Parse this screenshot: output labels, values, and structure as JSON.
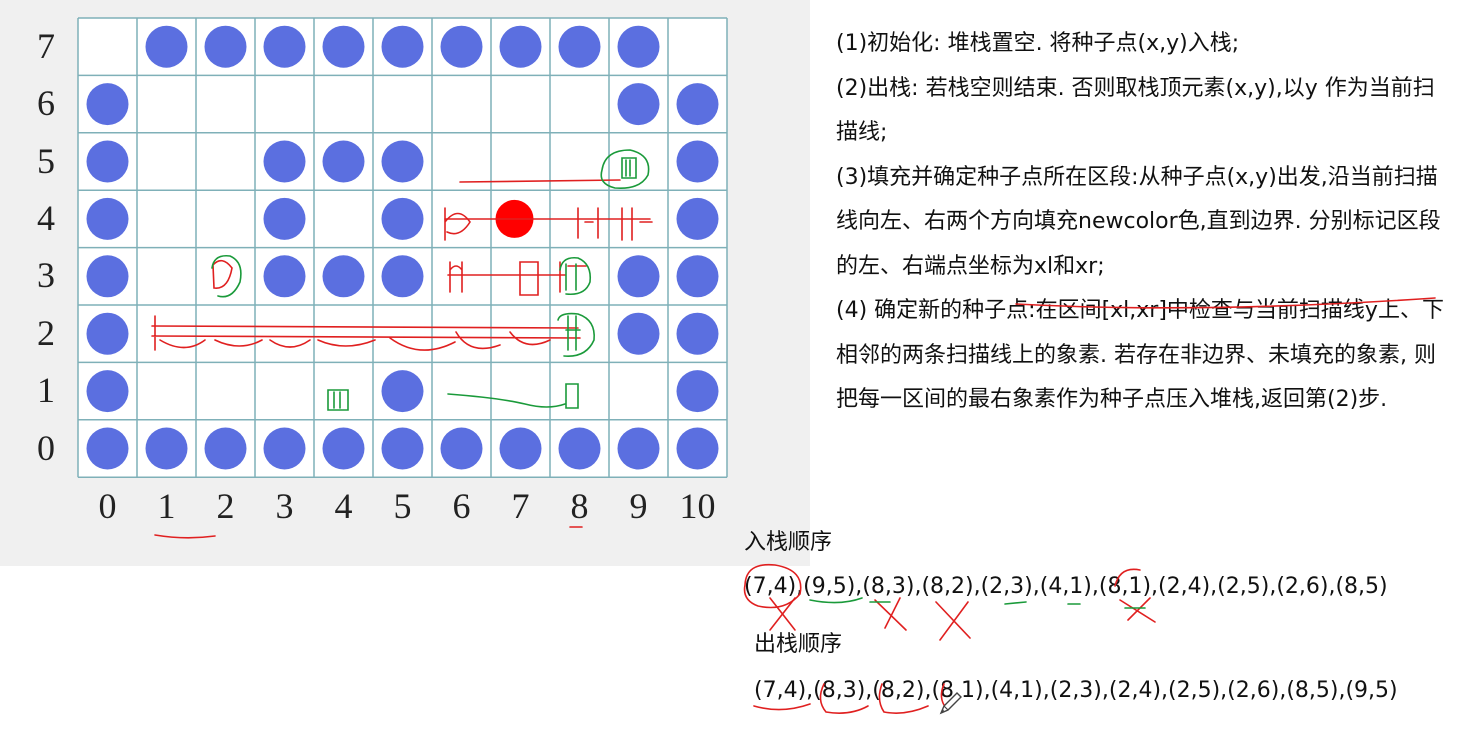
{
  "grid": {
    "x_labels": [
      "0",
      "1",
      "2",
      "3",
      "4",
      "5",
      "6",
      "7",
      "8",
      "9",
      "10"
    ],
    "y_labels": [
      "7",
      "6",
      "5",
      "4",
      "3",
      "2",
      "1",
      "0"
    ],
    "cell_color": "#ffffff",
    "line_color": "#7fb0b8",
    "dot_color": "#5b6fe0",
    "seed_color": "#ff0000",
    "boundary_dots": [
      [
        1,
        7
      ],
      [
        2,
        7
      ],
      [
        3,
        7
      ],
      [
        4,
        7
      ],
      [
        5,
        7
      ],
      [
        6,
        7
      ],
      [
        7,
        7
      ],
      [
        8,
        7
      ],
      [
        9,
        7
      ],
      [
        0,
        6
      ],
      [
        9,
        6
      ],
      [
        10,
        6
      ],
      [
        0,
        5
      ],
      [
        3,
        5
      ],
      [
        4,
        5
      ],
      [
        5,
        5
      ],
      [
        10,
        5
      ],
      [
        0,
        4
      ],
      [
        3,
        4
      ],
      [
        5,
        4
      ],
      [
        10,
        4
      ],
      [
        0,
        3
      ],
      [
        3,
        3
      ],
      [
        4,
        3
      ],
      [
        5,
        3
      ],
      [
        9,
        3
      ],
      [
        10,
        3
      ],
      [
        0,
        2
      ],
      [
        9,
        2
      ],
      [
        10,
        2
      ],
      [
        0,
        1
      ],
      [
        5,
        1
      ],
      [
        10,
        1
      ],
      [
        0,
        0
      ],
      [
        1,
        0
      ],
      [
        2,
        0
      ],
      [
        3,
        0
      ],
      [
        4,
        0
      ],
      [
        5,
        0
      ],
      [
        6,
        0
      ],
      [
        7,
        0
      ],
      [
        8,
        0
      ],
      [
        9,
        0
      ],
      [
        10,
        0
      ]
    ],
    "seed_point": [
      7,
      4
    ]
  },
  "steps": [
    "(1)初始化: 堆栈置空. 将种子点(x,y)入栈;",
    "(2)出栈: 若栈空则结束. 否则取栈顶元素(x,y),以y 作为当前扫描线;",
    "(3)填充并确定种子点所在区段:从种子点(x,y)出发,沿当前扫描线向左、右两个方向填充newcolor色,直到边界. 分别标记区段的左、右端点坐标为xl和xr;",
    "(4) 确定新的种子点:在区间[xl,xr]中检查与当前扫描线y上、下相邻的两条扫描线上的象素. 若存在非边界、未填充的象素, 则把每一区间的最右象素作为种子点压入堆栈,返回第(2)步."
  ],
  "push_order": {
    "title": "入栈顺序",
    "sequence": "(7,4),(9,5),(8,3),(8,2),(2,3),(4,1),(8,1),(2,4),(2,5),(2,6),(8,5)"
  },
  "pop_order": {
    "title": "出栈顺序",
    "sequence": "(7,4),(8,3),(8,2),(8,1),(4,1),(2,3),(2,4),(2,5),(2,6),(8,5),(9,5)"
  },
  "annotation_colors": {
    "red": "#e02020",
    "green": "#1a9a3a"
  }
}
